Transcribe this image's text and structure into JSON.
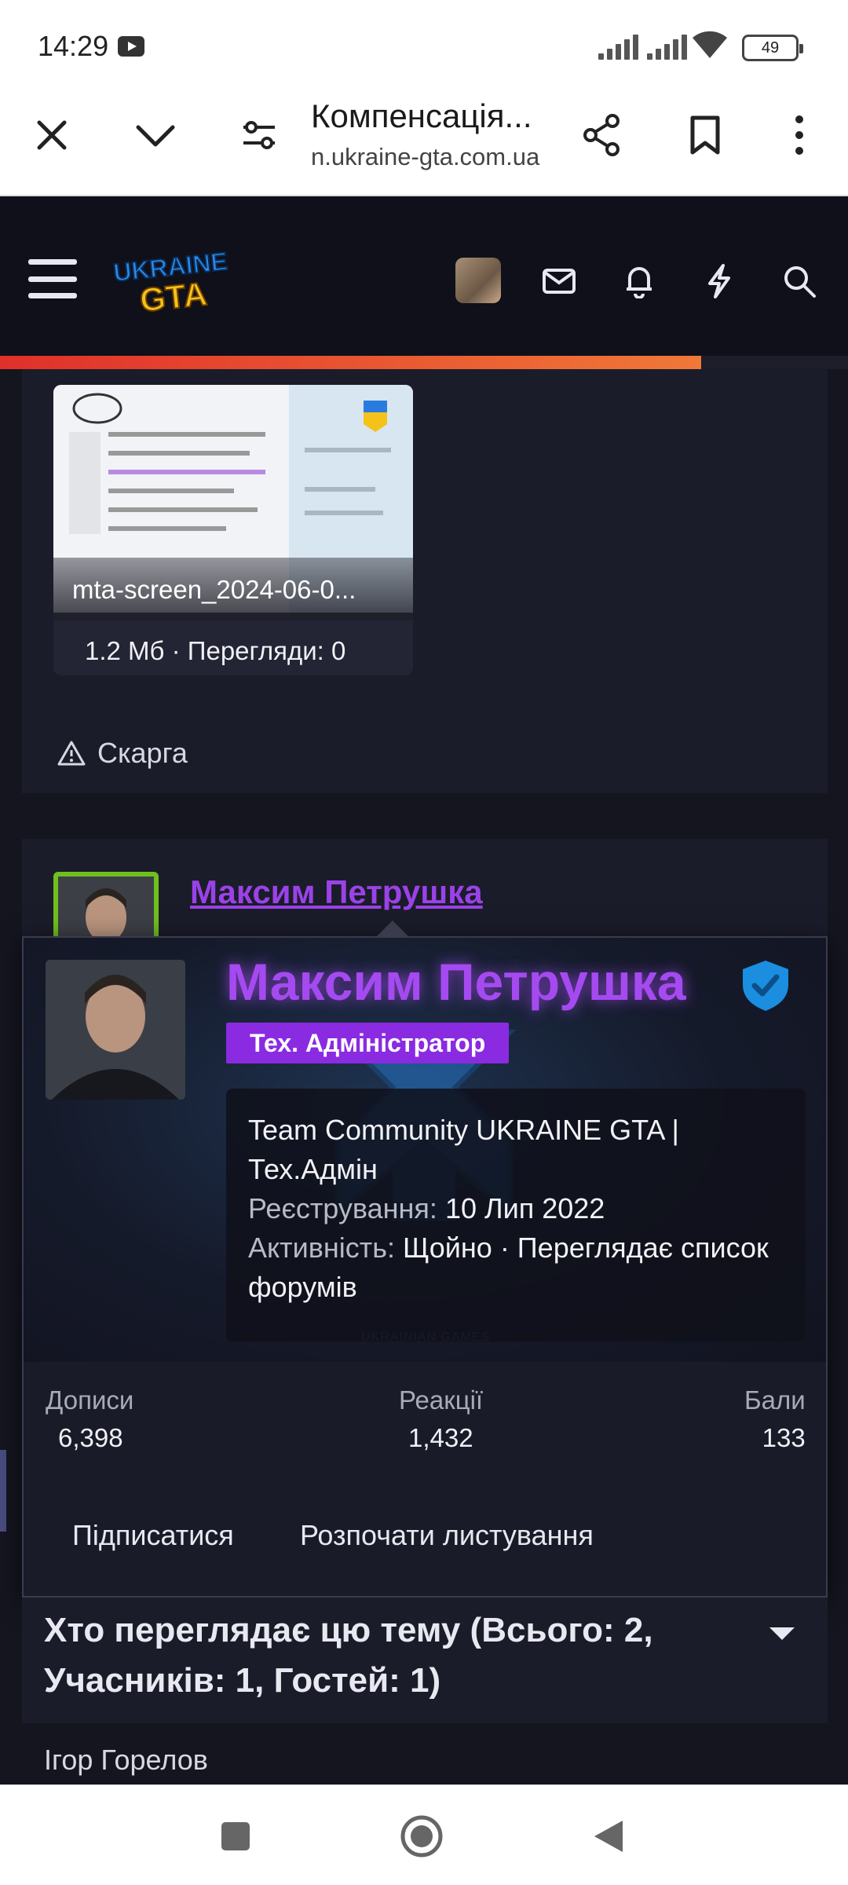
{
  "status_bar": {
    "time": "14:29",
    "battery": "49",
    "icons": [
      "youtube-icon",
      "signal-icon",
      "signal-icon",
      "wifi-icon",
      "battery-icon"
    ]
  },
  "browser": {
    "title": "Компенсація...",
    "url": "n.ukraine-gta.com.ua",
    "icons": [
      "close-icon",
      "chevron-down-icon",
      "tune-icon",
      "share-icon",
      "bookmark-icon",
      "more-vert-icon"
    ]
  },
  "site_header": {
    "logo_line1": "UKRAINE",
    "logo_line2": "GTA",
    "icons": [
      "menu-icon",
      "avatar",
      "mail-icon",
      "bell-icon",
      "bolt-icon",
      "search-icon"
    ],
    "read_progress": 0.827
  },
  "attachment": {
    "filename": "mta-screen_2024-06-0...",
    "meta": "1.2 Мб · Перегляди: 0"
  },
  "report_label": "Скарга",
  "post_author": {
    "name": "Максим Петрушка"
  },
  "popup": {
    "name": "Максим Петрушка",
    "role": "Тех. Адміністратор",
    "team_line": "Team Community UKRAINE GTA | Тех.Адмін",
    "registered_label": "Реєстрування:",
    "registered_value": "10 Лип 2022",
    "activity_label": "Активність:",
    "activity_value": "Щойно · Переглядає список форумів",
    "banner_caption": "UKRAINIAN GAMES",
    "stats": {
      "posts_label": "Дописи",
      "posts_value": "6,398",
      "reactions_label": "Реакції",
      "reactions_value": "1,432",
      "points_label": "Бали",
      "points_value": "133"
    },
    "follow_label": "Підписатися",
    "message_label": "Розпочати листування"
  },
  "viewers": {
    "title": "Хто переглядає цю тему (Всього: 2, Учасників: 1, Гостей: 1)",
    "member": "Ігор Горелов"
  },
  "colors": {
    "accent_purple": "#a54af0",
    "badge_purple": "#8a2be2",
    "progress_red": "#e0302a",
    "progress_orange": "#f07838",
    "avatar_border_green": "#6fbf1f",
    "page_bg": "#14151f"
  }
}
